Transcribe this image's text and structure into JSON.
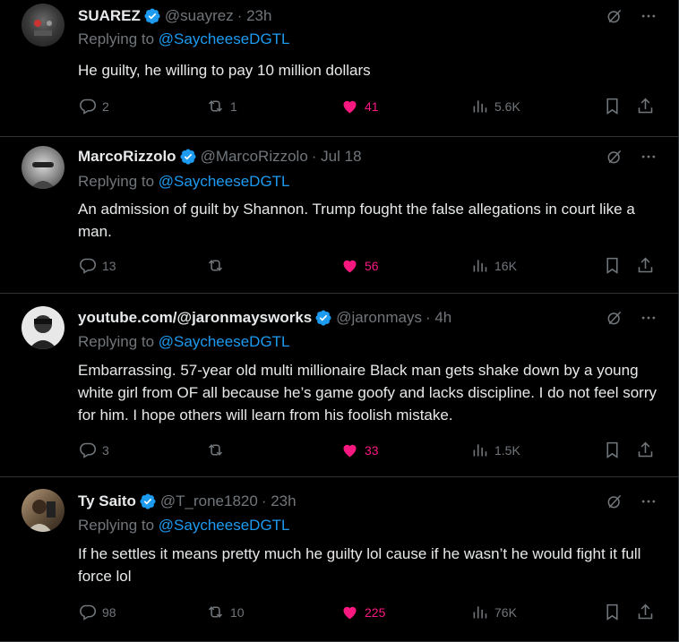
{
  "tweets": [
    {
      "name": "SUAREZ",
      "handle": "@suayrez",
      "time": "· 23h",
      "reply_prefix": "Replying to",
      "reply_mention": "@SaycheeseDGTL",
      "text": "He guilty, he willing to pay 10 million dollars",
      "replies": "2",
      "reposts": "1",
      "likes": "41",
      "views": "5.6K"
    },
    {
      "name": "MarcoRizzolo",
      "handle": "@MarcoRizzolo",
      "time": "· Jul 18",
      "reply_prefix": "Replying to",
      "reply_mention": "@SaycheeseDGTL",
      "text": "An admission of guilt by Shannon. Trump fought the false allegations in court like a man.",
      "replies": "13",
      "reposts": "",
      "likes": "56",
      "views": "16K"
    },
    {
      "name": "youtube.com/@jaronmaysworks",
      "handle": "@jaronmays",
      "time": "· 4h",
      "reply_prefix": "Replying to",
      "reply_mention": "@SaycheeseDGTL",
      "text": "Embarrassing. 57-year old multi millionaire Black man gets shake down by a young white girl from OF all because he’s game goofy and lacks discipline. I do not feel sorry for him. I hope others will learn from his foolish mistake.",
      "replies": "3",
      "reposts": "",
      "likes": "33",
      "views": "1.5K"
    },
    {
      "name": "Ty Saito",
      "handle": "@T_rone1820",
      "time": "· 23h",
      "reply_prefix": "Replying to",
      "reply_mention": "@SaycheeseDGTL",
      "text": "If he settles it means pretty much he guilty lol cause if he wasn’t he would fight it full force lol",
      "replies": "98",
      "reposts": "10",
      "likes": "225",
      "views": "76K"
    }
  ],
  "colors": {
    "accent": "#1d9bf0",
    "like": "#f91880",
    "muted": "#71767b",
    "text": "#e7e9ea",
    "divider": "#2f3336"
  },
  "icons": [
    "verified-badge-icon",
    "grok-icon",
    "more-icon",
    "reply-icon",
    "repost-icon",
    "like-icon",
    "views-icon",
    "bookmark-icon",
    "share-icon"
  ]
}
